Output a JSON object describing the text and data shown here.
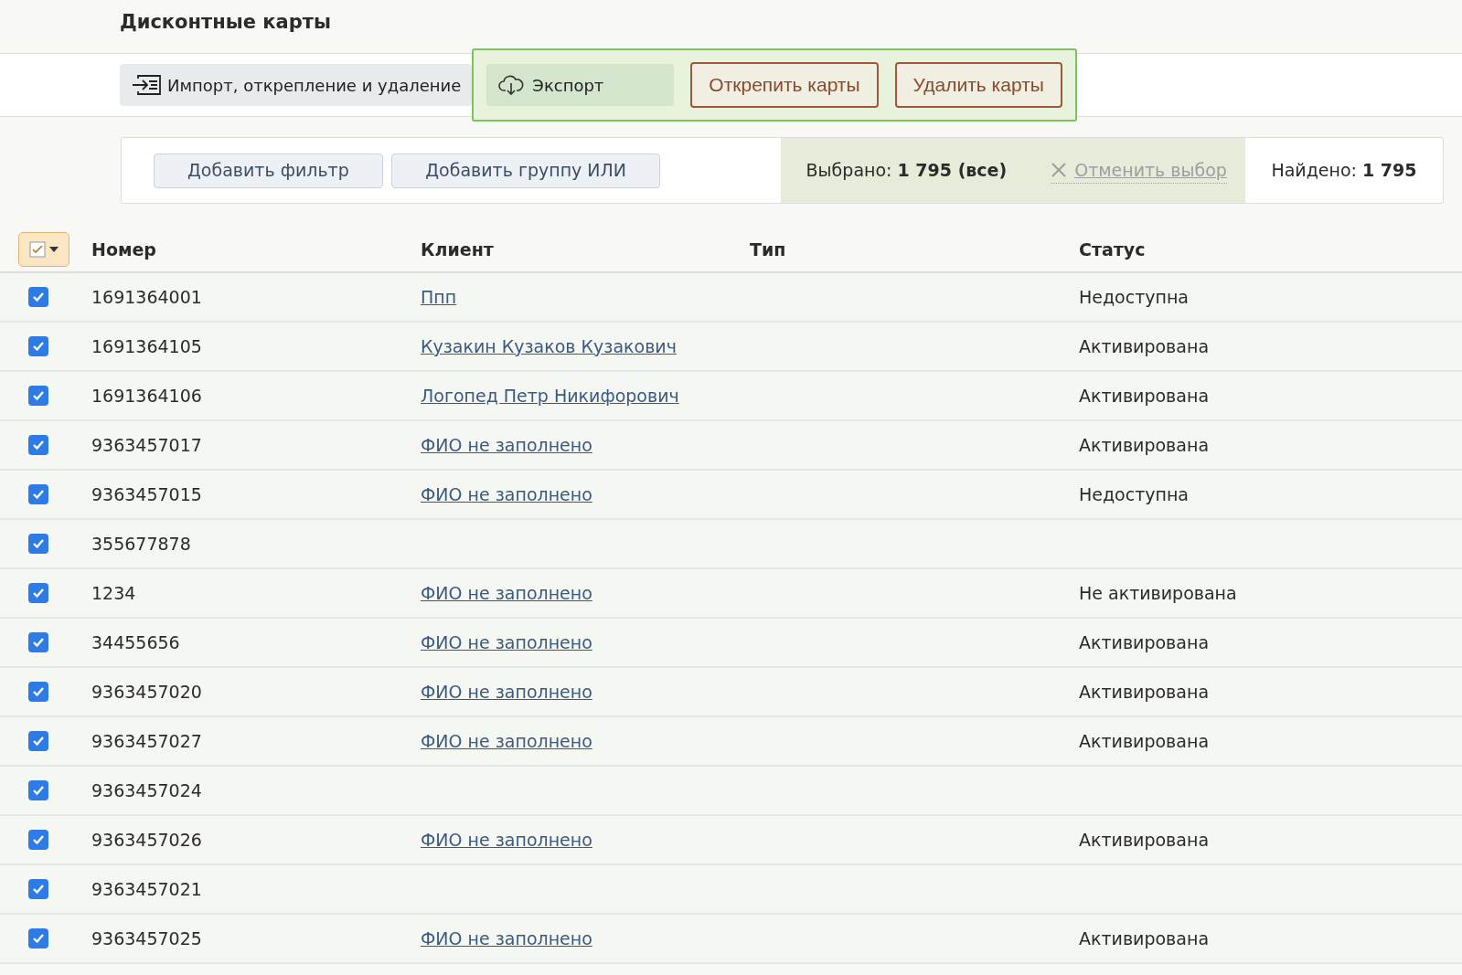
{
  "page_title": "Дисконтные карты",
  "toolbar": {
    "import_button": "Импорт, открепление и удаление",
    "export_button": "Экспорт",
    "actions": [
      "Открепить карты",
      "Удалить карты"
    ]
  },
  "filter_bar": {
    "buttons": [
      "Добавить фильтр",
      "Добавить группу ИЛИ"
    ],
    "selected": "Выбрано: **1 795 (все)**",
    "cancel": "Отменить выбор",
    "found": "Найдено: **1 795**"
  },
  "table": {
    "select_all_checked": true,
    "columns": [
      "Номер",
      "Клиент",
      "Тип",
      "Статус"
    ],
    "rows": [
      {
        "number": "1691364001",
        "client": "Ппп",
        "status": "Недоступна",
        "checked": true
      },
      {
        "number": "1691364105",
        "client": "Кузакин Кузаков Кузакович",
        "status": "Активирована",
        "checked": true
      },
      {
        "number": "1691364106",
        "client": "Логопед Петр Никифорович",
        "status": "Активирована",
        "checked": true
      },
      {
        "number": "9363457017",
        "client": "ФИО не заполнено",
        "status": "Активирована",
        "checked": true
      },
      {
        "number": "9363457015",
        "client": "ФИО не заполнено",
        "status": "Недоступна",
        "checked": true
      },
      {
        "number": "355677878",
        "checked": true
      },
      {
        "number": "1234",
        "client": "ФИО не заполнено",
        "status": "Не активирована",
        "checked": true
      },
      {
        "number": "34455656",
        "client": "ФИО не заполнено",
        "status": "Активирована",
        "checked": true
      },
      {
        "number": "9363457020",
        "client": "ФИО не заполнено",
        "status": "Активирована",
        "checked": true
      },
      {
        "number": "9363457027",
        "client": "ФИО не заполнено",
        "status": "Активирована",
        "checked": true
      },
      {
        "number": "9363457024",
        "checked": true
      },
      {
        "number": "9363457026",
        "client": "ФИО не заполнено",
        "status": "Активирована",
        "checked": true
      },
      {
        "number": "9363457021",
        "checked": true
      },
      {
        "number": "9363457025",
        "client": "ФИО не заполнено",
        "status": "Активирована",
        "checked": true
      }
    ]
  }
}
